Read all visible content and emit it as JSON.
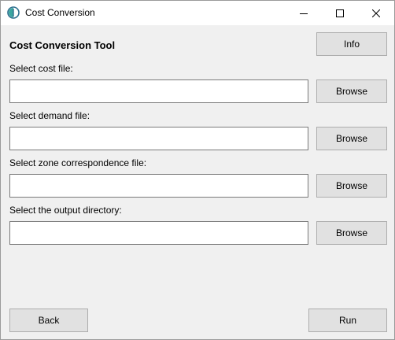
{
  "window": {
    "title": "Cost Conversion",
    "controls": {
      "minimize": "minimize-icon",
      "maximize": "maximize-icon",
      "close": "close-icon"
    }
  },
  "tool": {
    "heading": "Cost Conversion Tool",
    "info_label": "Info"
  },
  "fields": [
    {
      "label": "Select cost file:",
      "value": "",
      "browse_label": "Browse"
    },
    {
      "label": "Select demand file:",
      "value": "",
      "browse_label": "Browse"
    },
    {
      "label": "Select zone correspondence file:",
      "value": "",
      "browse_label": "Browse"
    },
    {
      "label": "Select the output directory:",
      "value": "",
      "browse_label": "Browse"
    }
  ],
  "footer": {
    "back_label": "Back",
    "run_label": "Run"
  }
}
